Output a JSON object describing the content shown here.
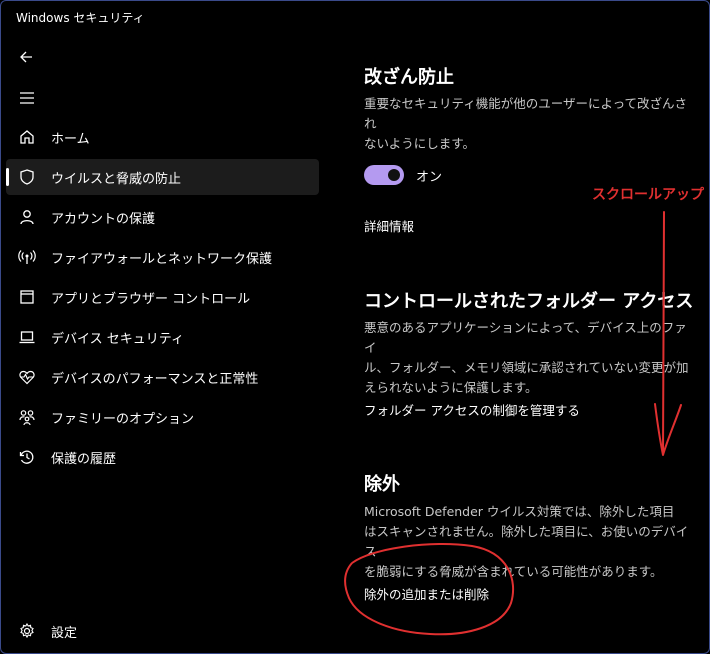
{
  "window": {
    "title": "Windows セキュリティ"
  },
  "sidebar": {
    "items": [
      {
        "label": "ホーム",
        "icon": "home-icon"
      },
      {
        "label": "ウイルスと脅威の防止",
        "icon": "shield-icon",
        "selected": true
      },
      {
        "label": "アカウントの保護",
        "icon": "person-icon"
      },
      {
        "label": "ファイアウォールとネットワーク保護",
        "icon": "antenna-icon"
      },
      {
        "label": "アプリとブラウザー コントロール",
        "icon": "app-window-icon"
      },
      {
        "label": "デバイス セキュリティ",
        "icon": "laptop-icon"
      },
      {
        "label": "デバイスのパフォーマンスと正常性",
        "icon": "heart-pulse-icon"
      },
      {
        "label": "ファミリーのオプション",
        "icon": "family-icon"
      },
      {
        "label": "保護の履歴",
        "icon": "history-icon"
      }
    ],
    "settings_label": "設定"
  },
  "main": {
    "tamper": {
      "title": "改ざん防止",
      "desc_line1": "重要なセキュリティ機能が他のユーザーによって改ざんされ",
      "desc_line2": "ないようにします。",
      "toggle_label": "オン",
      "toggle_on": true,
      "link": "詳細情報"
    },
    "cfa": {
      "title": "コントロールされたフォルダー アクセス",
      "desc_line1": "悪意のあるアプリケーションによって、デバイス上のファイ",
      "desc_line2": "ル、フォルダー、メモリ領域に承認されていない変更が加",
      "desc_line3": "えられないように保護します。",
      "link": "フォルダー アクセスの制御を管理する"
    },
    "exclusions": {
      "title": "除外",
      "desc_line1": "Microsoft Defender ウイルス対策では、除外した項目",
      "desc_line2": "はスキャンされません。除外した項目に、お使いのデバイス",
      "desc_line3": "を脆弱にする脅威が含まれている可能性があります。",
      "link": "除外の追加または削除"
    }
  },
  "annotation": {
    "text": "スクロールアップ",
    "color": "#e03030"
  },
  "colors": {
    "accent": "#b49af0",
    "background": "#000000",
    "selected_item": "#1c1c1c"
  }
}
